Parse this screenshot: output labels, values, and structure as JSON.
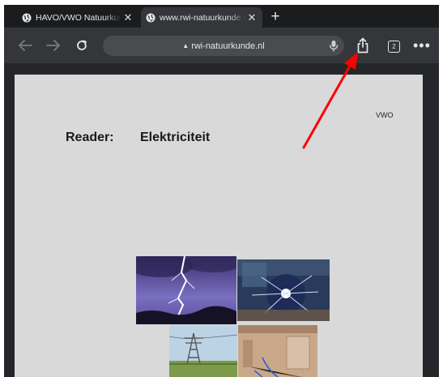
{
  "browser": {
    "tabs": [
      {
        "title": "HAVO/VWO Natuurkunde",
        "active": false
      },
      {
        "title": "www.rwi-natuurkunde.nl",
        "active": true
      }
    ],
    "new_tab_symbol": "+",
    "close_symbol": "✕",
    "url": "rwi-natuurkunde.nl",
    "lock_symbol": "▲",
    "tab_count": "2",
    "more_symbol": "•••",
    "icons": {
      "favicon": "globe-icon",
      "back": "arrow-left-icon",
      "forward": "arrow-right-icon",
      "reload": "reload-icon",
      "mic": "microphone-icon",
      "share": "share-icon"
    }
  },
  "page": {
    "level": "VWO",
    "reader_label": "Reader:",
    "reader_title": "Elektriciteit",
    "images": [
      "lightning",
      "plasma-ball",
      "power-pylon",
      "room-wiring"
    ]
  },
  "annotation": {
    "arrow_color": "#ff0000"
  }
}
